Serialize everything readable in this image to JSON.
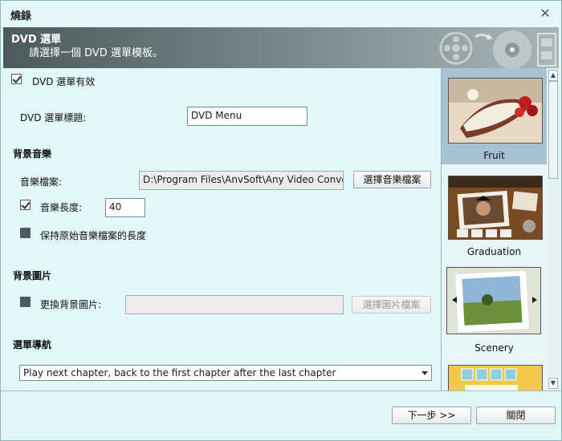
{
  "window": {
    "title": "燒錄",
    "close_label": "✕"
  },
  "header": {
    "title": "DVD 選單",
    "subtitle": "請選擇一個 DVD 選單模板。"
  },
  "dvd_menu": {
    "enable_label": "DVD 選單有效",
    "enable_checked": true,
    "title_label": "DVD 選單標題:",
    "title_value": "DVD Menu"
  },
  "music": {
    "section_label": "背景音樂",
    "file_label": "音樂檔案:",
    "file_value": "D:\\Program Files\\AnvSoft\\Any Video Converter",
    "choose_button": "選擇音樂檔案",
    "length_label": "音樂長度:",
    "length_checked": true,
    "length_value": "40",
    "keep_original_label": "保持原始音樂檔案的長度",
    "keep_original_checked": false
  },
  "background_image": {
    "section_label": "背景圖片",
    "change_label": "更換背景圖片:",
    "change_checked": false,
    "path_value": "",
    "choose_button": "選擇圖片檔案"
  },
  "navigation": {
    "section_label": "選單導航",
    "selected_option": "Play next chapter, back to the first chapter after the last chapter"
  },
  "templates": [
    {
      "name": "Fruit",
      "selected": true
    },
    {
      "name": "Graduation",
      "selected": false
    },
    {
      "name": "Scenery",
      "selected": false
    }
  ],
  "footer": {
    "next_button": "下一步 >>",
    "close_button": "關閉"
  },
  "colors": {
    "background": "#dff5f6",
    "header_dark": "#4d5a5c",
    "selected_template": "#a6c2d3"
  }
}
